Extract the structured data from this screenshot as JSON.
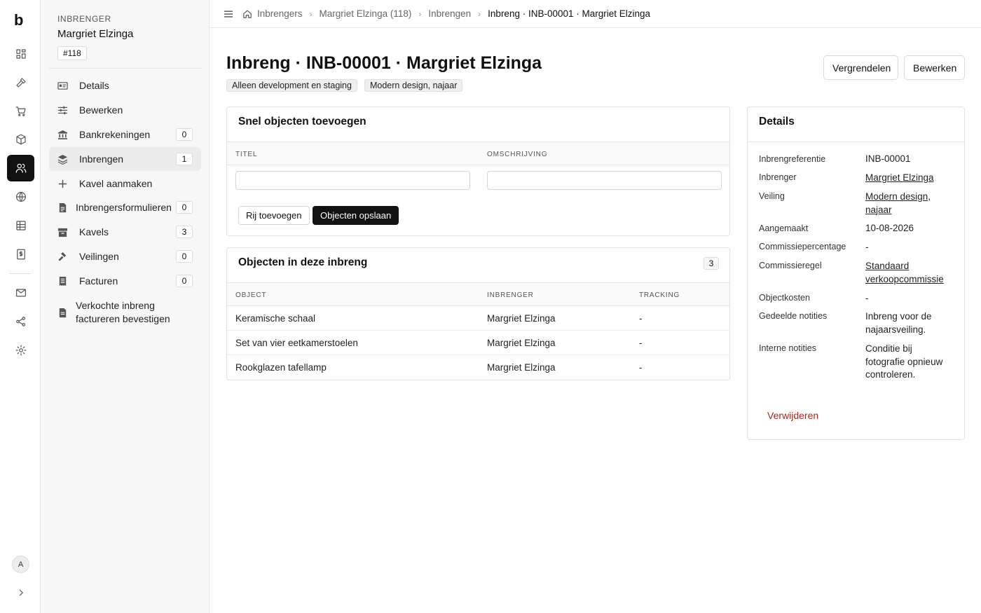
{
  "rail": {
    "logo": "b",
    "avatar": "A",
    "icons": [
      "dashboard-icon",
      "hammer-icon",
      "cart-icon",
      "box-icon",
      "users-icon",
      "globe-icon",
      "table-icon",
      "invoice-icon",
      "mail-icon",
      "share-icon",
      "gear-icon",
      "chevron-right-icon"
    ]
  },
  "sidebar": {
    "eyebrow": "INBRENGER",
    "name": "Margriet Elzinga",
    "id_badge": "#118",
    "items": [
      {
        "label": "Details",
        "count": null,
        "icon": "id-card-icon"
      },
      {
        "label": "Bewerken",
        "count": null,
        "icon": "sliders-icon"
      },
      {
        "label": "Bankrekeningen",
        "count": "0",
        "icon": "bank-icon"
      },
      {
        "label": "Inbrengen",
        "count": "1",
        "icon": "layers-icon"
      },
      {
        "label": "Kavel aanmaken",
        "count": null,
        "icon": "plus-icon"
      },
      {
        "label": "Inbrengersformulieren",
        "count": "0",
        "icon": "file-icon"
      },
      {
        "label": "Kavels",
        "count": "3",
        "icon": "archive-icon"
      },
      {
        "label": "Veilingen",
        "count": "0",
        "icon": "gavel-icon"
      },
      {
        "label": "Facturen",
        "count": "0",
        "icon": "receipt-icon"
      },
      {
        "label": "Verkochte inbreng factureren bevestigen",
        "count": null,
        "icon": "file-check-icon"
      }
    ]
  },
  "breadcrumb": {
    "items": [
      "Inbrengers",
      "Margriet Elzinga (118)",
      "Inbrengen",
      "Inbreng · INB-00001 · Margriet Elzinga"
    ]
  },
  "page": {
    "title": "Inbreng · INB-00001 · Margriet Elzinga",
    "tags": [
      "Alleen development en staging",
      "Modern design, najaar"
    ],
    "lock_button": "Vergrendelen",
    "edit_button": "Bewerken"
  },
  "quick_add": {
    "title": "Snel objecten toevoegen",
    "col_title": "TITEL",
    "col_desc": "OMSCHRIJVING",
    "title_value": "",
    "desc_value": "",
    "add_row_button": "Rij toevoegen",
    "save_button": "Objecten opslaan"
  },
  "objects": {
    "title": "Objecten in deze inbreng",
    "count": "3",
    "columns": [
      "OBJECT",
      "INBRENGER",
      "TRACKING"
    ],
    "rows": [
      {
        "object": "Keramische schaal",
        "inbrenger": "Margriet Elzinga",
        "tracking": "-"
      },
      {
        "object": "Set van vier eetkamerstoelen",
        "inbrenger": "Margriet Elzinga",
        "tracking": "-"
      },
      {
        "object": "Rookglazen tafellamp",
        "inbrenger": "Margriet Elzinga",
        "tracking": "-"
      }
    ]
  },
  "details": {
    "title": "Details",
    "fields": [
      {
        "label": "Inbrengreferentie",
        "value": "INB-00001",
        "link": false
      },
      {
        "label": "Inbrenger",
        "value": "Margriet Elzinga",
        "link": true
      },
      {
        "label": "Veiling",
        "value": "Modern design, najaar",
        "link": true
      },
      {
        "label": "Aangemaakt",
        "value": "10-08-2026",
        "link": false
      },
      {
        "label": "Commissiepercentage",
        "value": "-",
        "link": false
      },
      {
        "label": "Commissieregel",
        "value": "Standaard verkoopcommissie",
        "link": true
      },
      {
        "label": "Objectkosten",
        "value": "-",
        "link": false
      },
      {
        "label": "Gedeelde notities",
        "value": "Inbreng voor de najaarsveiling.",
        "link": false
      },
      {
        "label": "Interne notities",
        "value": "Conditie bij fotografie opnieuw controleren.",
        "link": false
      }
    ],
    "delete_button": "Verwijderen"
  }
}
